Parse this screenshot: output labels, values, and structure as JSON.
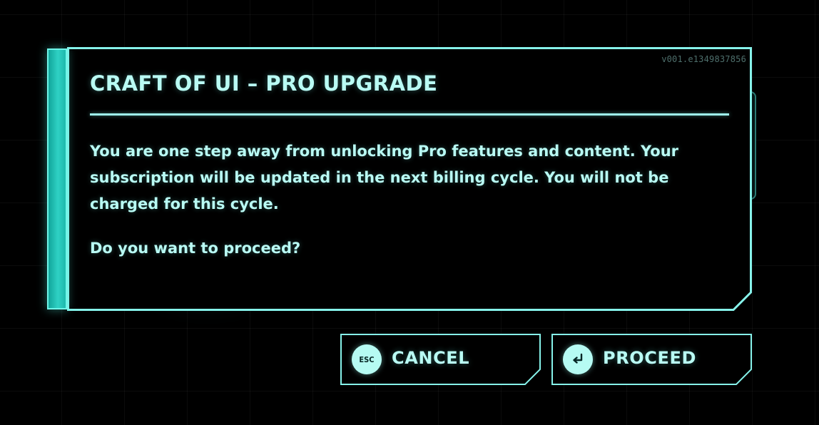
{
  "dialog": {
    "version": "v001.e1349837856",
    "title": "CRAFT OF UI – PRO UPGRADE",
    "body": "You are one step away from unlocking Pro features and content. Your subscription will be updated in the next billing cycle. You will not be charged for this cycle.",
    "question": "Do you want to proceed?"
  },
  "buttons": {
    "cancel": {
      "key": "ESC",
      "label": "CANCEL",
      "icon": "esc-key-icon"
    },
    "proceed": {
      "label": "PROCEED",
      "icon": "enter-arrow-icon"
    }
  },
  "colors": {
    "accent": "#6ff5e8",
    "text": "#b9fbf4",
    "background": "#000000"
  }
}
